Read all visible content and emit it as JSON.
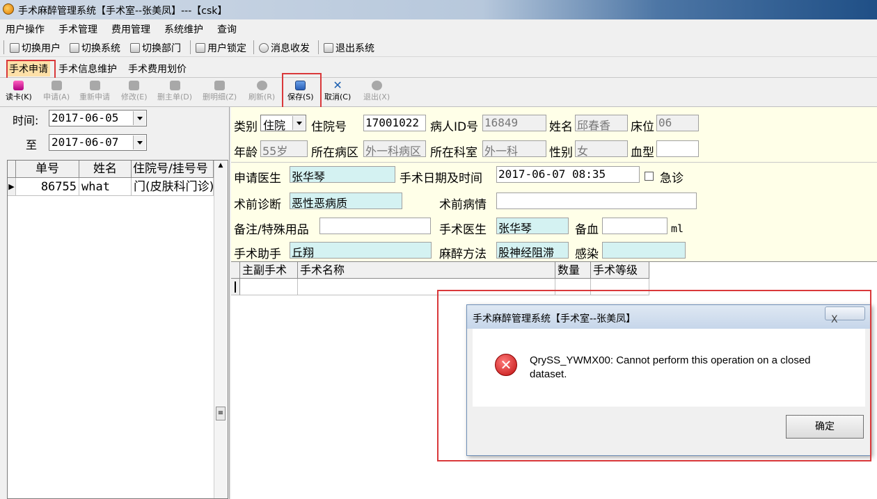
{
  "window": {
    "title": "手术麻醉管理系统【手术室--张美凤】---【csk】"
  },
  "menu": [
    "用户操作",
    "手术管理",
    "费用管理",
    "系统维护",
    "查询"
  ],
  "quickbar": [
    {
      "label": "切换用户",
      "icon": "users-icon"
    },
    {
      "label": "切换系统",
      "icon": "switch-system-icon"
    },
    {
      "label": "切换部门",
      "icon": "department-icon"
    },
    {
      "label": "用户锁定",
      "icon": "lock-user-icon"
    },
    {
      "label": "消息收发",
      "icon": "message-icon"
    },
    {
      "label": "退出系统",
      "icon": "exit-icon"
    }
  ],
  "tabs": [
    "手术申请",
    "手术信息维护",
    "手术费用划价"
  ],
  "actions": [
    {
      "label": "读卡(K)",
      "enabled": true
    },
    {
      "label": "申请(A)",
      "enabled": false
    },
    {
      "label": "重新申请",
      "enabled": false
    },
    {
      "label": "修改(E)",
      "enabled": false
    },
    {
      "label": "删主单(D)",
      "enabled": false
    },
    {
      "label": "删明细(Z)",
      "enabled": false
    },
    {
      "label": "刷新(R)",
      "enabled": false
    },
    {
      "label": "保存(S)",
      "enabled": true
    },
    {
      "label": "取消(C)",
      "enabled": true
    },
    {
      "label": "退出(X)",
      "enabled": false
    }
  ],
  "filter": {
    "time_label": "时间:",
    "to_label": "至",
    "from": "2017-06-05",
    "to": "2017-06-07"
  },
  "list": {
    "headers": [
      "单号",
      "姓名",
      "住院号/挂号号"
    ],
    "rows": [
      {
        "id": "86755",
        "name": "what",
        "reg": "门(皮肤科门诊)"
      }
    ]
  },
  "form": {
    "type_label": "类别",
    "type_value": "住院",
    "inpatient_label": "住院号",
    "inpatient_value": "17001022",
    "pid_label": "病人ID号",
    "pid_value": "16849",
    "name_label": "姓名",
    "name_value": "邱春香",
    "bed_label": "床位",
    "bed_value": "06",
    "age_label": "年龄",
    "age_value": "55岁",
    "ward_label": "所在病区",
    "ward_value": "外一科病区",
    "dept_label": "所在科室",
    "dept_value": "外一科",
    "sex_label": "性别",
    "sex_value": "女",
    "blood_label": "血型",
    "blood_value": "",
    "applicant_label": "申请医生",
    "applicant_value": "张华琴",
    "datetime_label": "手术日期及时间",
    "datetime_value": "2017-06-07 08:35",
    "urgent_label": "急诊",
    "prediag_label": "术前诊断",
    "prediag_value": "恶性恶病质",
    "precond_label": "术前病情",
    "precond_value": "",
    "remark_label": "备注/特殊用品",
    "remark_value": "",
    "surgeon_label": "手术医生",
    "surgeon_value": "张华琴",
    "blood_prep_label": "备血",
    "blood_prep_value": "",
    "blood_prep_unit": "ml",
    "assistant_label": "手术助手",
    "assistant_value": "丘翔",
    "anesthesia_label": "麻醉方法",
    "anesthesia_value": "股神经阻滞",
    "infection_label": "感染",
    "infection_value": ""
  },
  "detail_grid": {
    "headers": [
      "主副手术",
      "手术名称",
      "数量",
      "手术等级"
    ]
  },
  "dialog": {
    "title": "手术麻醉管理系统【手术室--张美凤】",
    "close": "X",
    "message": "QrySS_YWMX00: Cannot perform this operation on a closed dataset.",
    "ok": "确定"
  }
}
